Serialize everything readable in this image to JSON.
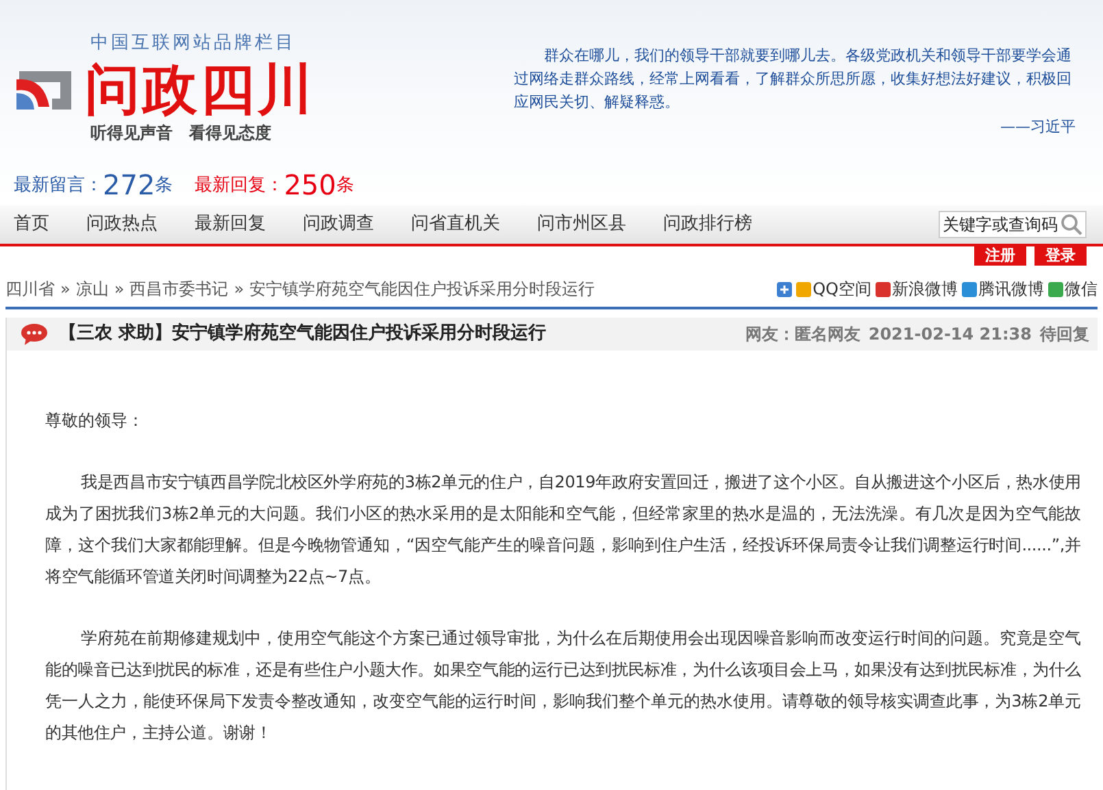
{
  "header": {
    "tagline_top": "中国互联网站品牌栏目",
    "logo_text": "问政四川",
    "slogan": "听得见声音　看得见态度",
    "quote": "群众在哪儿，我们的领导干部就要到哪儿去。各级党政机关和领导干部要学会通过网络走群众路线，经常上网看看，了解群众所思所愿，收集好想法好建议，积极回应网民关切、解疑释惑。",
    "quote_author": "——习近平"
  },
  "stats": [
    {
      "label": "最新留言：",
      "count": "272",
      "unit": "条",
      "color": "#2b5ca8"
    },
    {
      "label": "最新回复：",
      "count": "250",
      "unit": "条",
      "color": "#e60012"
    }
  ],
  "nav": {
    "items": [
      {
        "label": "首页",
        "selected": false
      },
      {
        "label": "问政热点",
        "selected": false
      },
      {
        "label": "最新回复",
        "selected": false
      },
      {
        "label": "问政调查",
        "selected": false
      },
      {
        "label": "问省直机关",
        "selected": false
      },
      {
        "label": "问市州区县",
        "selected": false
      },
      {
        "label": "问政排行榜",
        "selected": false
      }
    ],
    "search": {
      "placeholder": "关键字或查询码"
    },
    "buttons": [
      "注册",
      "登录"
    ]
  },
  "breadcrumb": {
    "separator": "»",
    "items": [
      "四川省",
      "凉山",
      "西昌市委书记",
      "安宁镇学府苑空气能因住户投诉采用分时段运行"
    ]
  },
  "share": [
    "QQ空间",
    "新浪微博",
    "腾讯微博",
    "微信"
  ],
  "post": {
    "title": "【三农 求助】安宁镇学府苑空气能因住户投诉采用分时段运行",
    "author": "网友：匿名网友",
    "date": "2021-02-14 21:38",
    "status": "待回复",
    "paragraphs": [
      {
        "kind": "greeting",
        "text": "尊敬的领导："
      },
      {
        "kind": "body",
        "text": "我是西昌市安宁镇西昌学院北校区外学府苑的3栋2单元的住户，自2019年政府安置回迁，搬进了这个小区。自从搬进这个小区后，热水使用成为了困扰我们3栋2单元的大问题。我们小区的热水采用的是太阳能和空气能，但经常家里的热水是温的，无法洗澡。有几次是因为空气能故障，这个我们大家都能理解。但是今晚物管通知，“因空气能产生的噪音问题，影响到住户生活，经投诉环保局责令让我们调整运行时间......”,并将空气能循环管道关闭时间调整为22点~7点。"
      },
      {
        "kind": "body",
        "text": "学府苑在前期修建规划中，使用空气能这个方案已通过领导审批，为什么在后期使用会出现因噪音影响而改变运行时间的问题。究竟是空气能的噪音已达到扰民的标准，还是有些住户小题大作。如果空气能的运行已达到扰民标准，为什么该项目会上马，如果没有达到扰民标准，为什么凭一人之力，能使环保局下发责令整改通知，改变空气能的运行时间，影响我们整个单元的热水使用。请尊敬的领导核实调查此事，为3栋2单元的其他住户，主持公道。谢谢！"
      }
    ]
  }
}
